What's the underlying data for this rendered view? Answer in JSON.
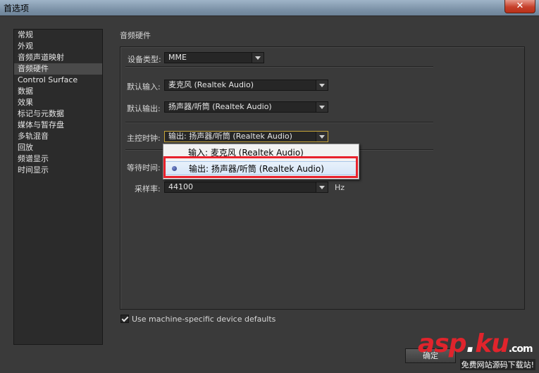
{
  "window": {
    "title": "首选项",
    "close_symbol": "✕"
  },
  "sidebar": {
    "items": [
      {
        "label": "常规"
      },
      {
        "label": "外观"
      },
      {
        "label": "音频声道映射"
      },
      {
        "label": "音频硬件",
        "selected": true
      },
      {
        "label": "Control Surface"
      },
      {
        "label": "数据"
      },
      {
        "label": "效果"
      },
      {
        "label": "标记与元数据"
      },
      {
        "label": "媒体与暂存盘"
      },
      {
        "label": "多轨混音"
      },
      {
        "label": "回放"
      },
      {
        "label": "频谱显示"
      },
      {
        "label": "时间显示"
      }
    ]
  },
  "main": {
    "section_title": "音频硬件",
    "device_type": {
      "label": "设备类型:",
      "value": "MME"
    },
    "default_input": {
      "label": "默认输入:",
      "value": "麦克风 (Realtek Audio)"
    },
    "default_output": {
      "label": "默认输出:",
      "value": "扬声器/听筒 (Realtek Audio)"
    },
    "master_clock": {
      "label": "主控时钟:",
      "value": "输出: 扬声器/听筒 (Realtek Audio)"
    },
    "latency": {
      "label": "等待时间:"
    },
    "sample_rate": {
      "label": "采样率:",
      "value": "44100",
      "unit": "Hz"
    },
    "dropdown_options": [
      {
        "label": "输入: 麦克风 (Realtek Audio)",
        "selected": false
      },
      {
        "label": "输出: 扬声器/听筒 (Realtek Audio)",
        "selected": true
      }
    ],
    "machine_defaults": {
      "label": "Use machine-specific device defaults",
      "checked": true
    }
  },
  "footer": {
    "button_label": "确定"
  },
  "watermark": {
    "brand_a": "asp",
    "brand_b": "ku",
    "domain_suffix": ".com",
    "tagline": "免费网站源码下载站!"
  },
  "colors": {
    "highlight": "#e8222c",
    "selection": "#d7e6f7",
    "focus": "#c4a338"
  }
}
